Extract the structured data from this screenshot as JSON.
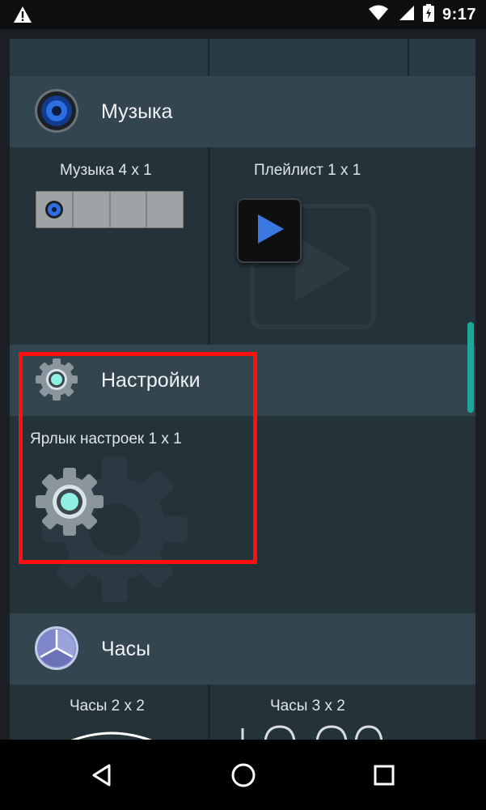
{
  "status_bar": {
    "time": "9:17",
    "icons": [
      "warning-icon",
      "wifi-icon",
      "signal-icon",
      "battery-icon"
    ]
  },
  "sections": {
    "music": {
      "title": "Музыка",
      "icon": "speaker-icon",
      "widgets": [
        {
          "label": "Музыка  4 x 1"
        },
        {
          "label": "Плейлист  1 x 1"
        }
      ]
    },
    "settings": {
      "title": "Настройки",
      "icon": "gear-icon",
      "widgets": [
        {
          "label": "Ярлык настроек  1 x 1"
        }
      ]
    },
    "clock": {
      "title": "Часы",
      "icon": "clock-icon",
      "widgets": [
        {
          "label": "Часы  2 x 2"
        },
        {
          "label": "Часы  3 x 2"
        }
      ]
    }
  },
  "nav_bar": {
    "buttons": [
      "back-icon",
      "home-icon",
      "recents-icon"
    ]
  },
  "colors": {
    "accent": "#19a89a",
    "highlight": "#ff1010",
    "header_bg": "#33454f",
    "cell_bg": "#24323a"
  }
}
